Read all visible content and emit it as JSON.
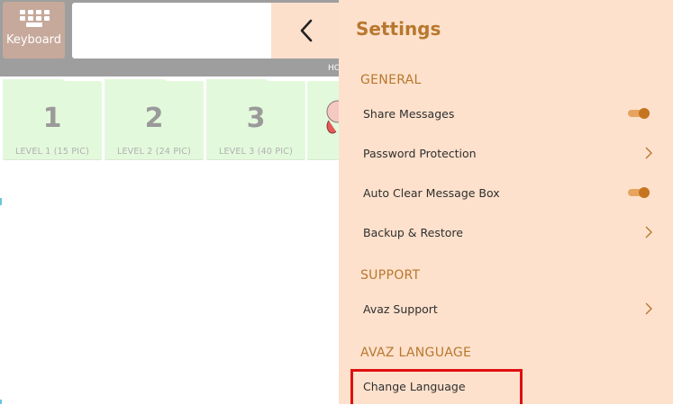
{
  "toolbar": {
    "keyboard_label": "Keyboard",
    "message_value": "",
    "breadcrumb": "HOME"
  },
  "tiles": [
    {
      "number": "1",
      "label": "LEVEL 1 (15 PIC)"
    },
    {
      "number": "2",
      "label": "LEVEL 2 (24 PIC)"
    },
    {
      "number": "3",
      "label": "LEVEL 3 (40 PIC)"
    }
  ],
  "settings": {
    "title": "Settings",
    "sections": {
      "general": "GENERAL",
      "support": "SUPPORT",
      "language": "AVAZ LANGUAGE"
    },
    "items": {
      "share_messages": {
        "label": "Share Messages",
        "enabled": true
      },
      "password_protection": {
        "label": "Password Protection"
      },
      "auto_clear": {
        "label": "Auto Clear Message Box",
        "enabled": true
      },
      "backup_restore": {
        "label": "Backup & Restore"
      },
      "avaz_support": {
        "label": "Avaz Support"
      },
      "change_language": {
        "label": "Change Language"
      }
    }
  },
  "colors": {
    "panel_bg": "#fde1cc",
    "accent": "#b8772e",
    "toggle_on": "#c57420",
    "tile_bg": "#e3f9dc",
    "highlight": "#e01010"
  }
}
